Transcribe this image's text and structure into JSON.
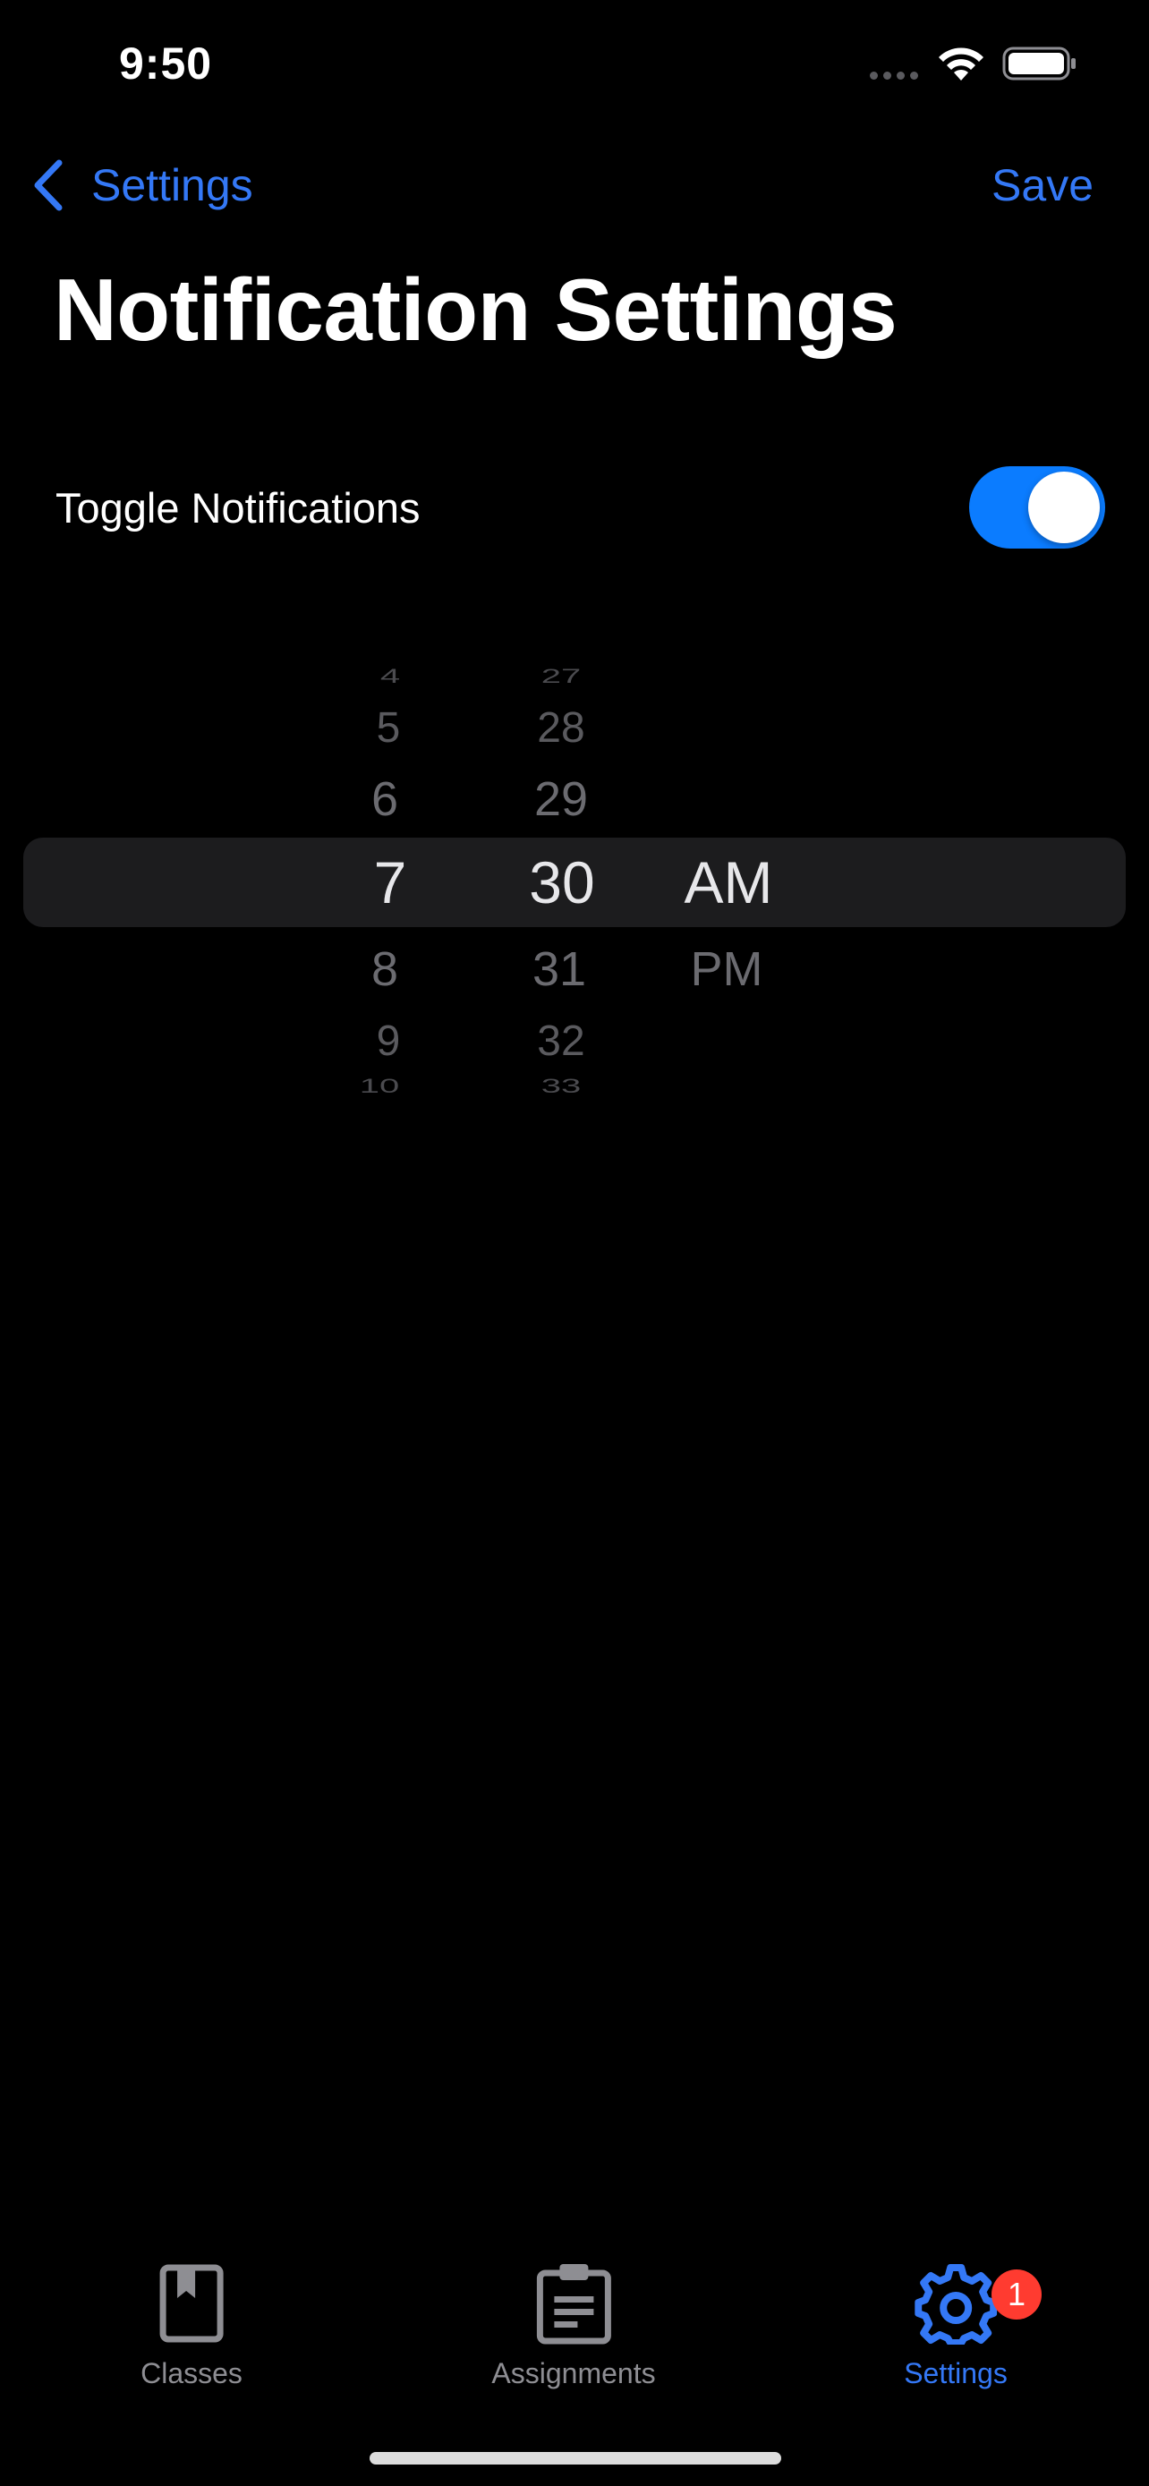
{
  "status_bar": {
    "time": "9:50"
  },
  "nav": {
    "back_label": "Settings",
    "save_label": "Save"
  },
  "page_title": "Notification Settings",
  "toggle_row": {
    "label": "Toggle Notifications",
    "enabled": true
  },
  "time_picker": {
    "hours": [
      "4",
      "5",
      "6",
      "7",
      "8",
      "9",
      "10"
    ],
    "minutes": [
      "27",
      "28",
      "29",
      "30",
      "31",
      "32",
      "33"
    ],
    "periods": [
      "AM",
      "PM"
    ],
    "selected": {
      "hour": "7",
      "minute": "30",
      "period": "AM"
    }
  },
  "tab_bar": {
    "tabs": [
      {
        "label": "Classes",
        "icon": "book-icon",
        "active": false
      },
      {
        "label": "Assignments",
        "icon": "clipboard-icon",
        "active": false
      },
      {
        "label": "Settings",
        "icon": "gear-icon",
        "active": true,
        "badge": "1"
      }
    ]
  },
  "colors": {
    "accent": "#3478f6",
    "toggle_on": "#0b7cff",
    "badge": "#ff3b30",
    "background": "#000000"
  }
}
